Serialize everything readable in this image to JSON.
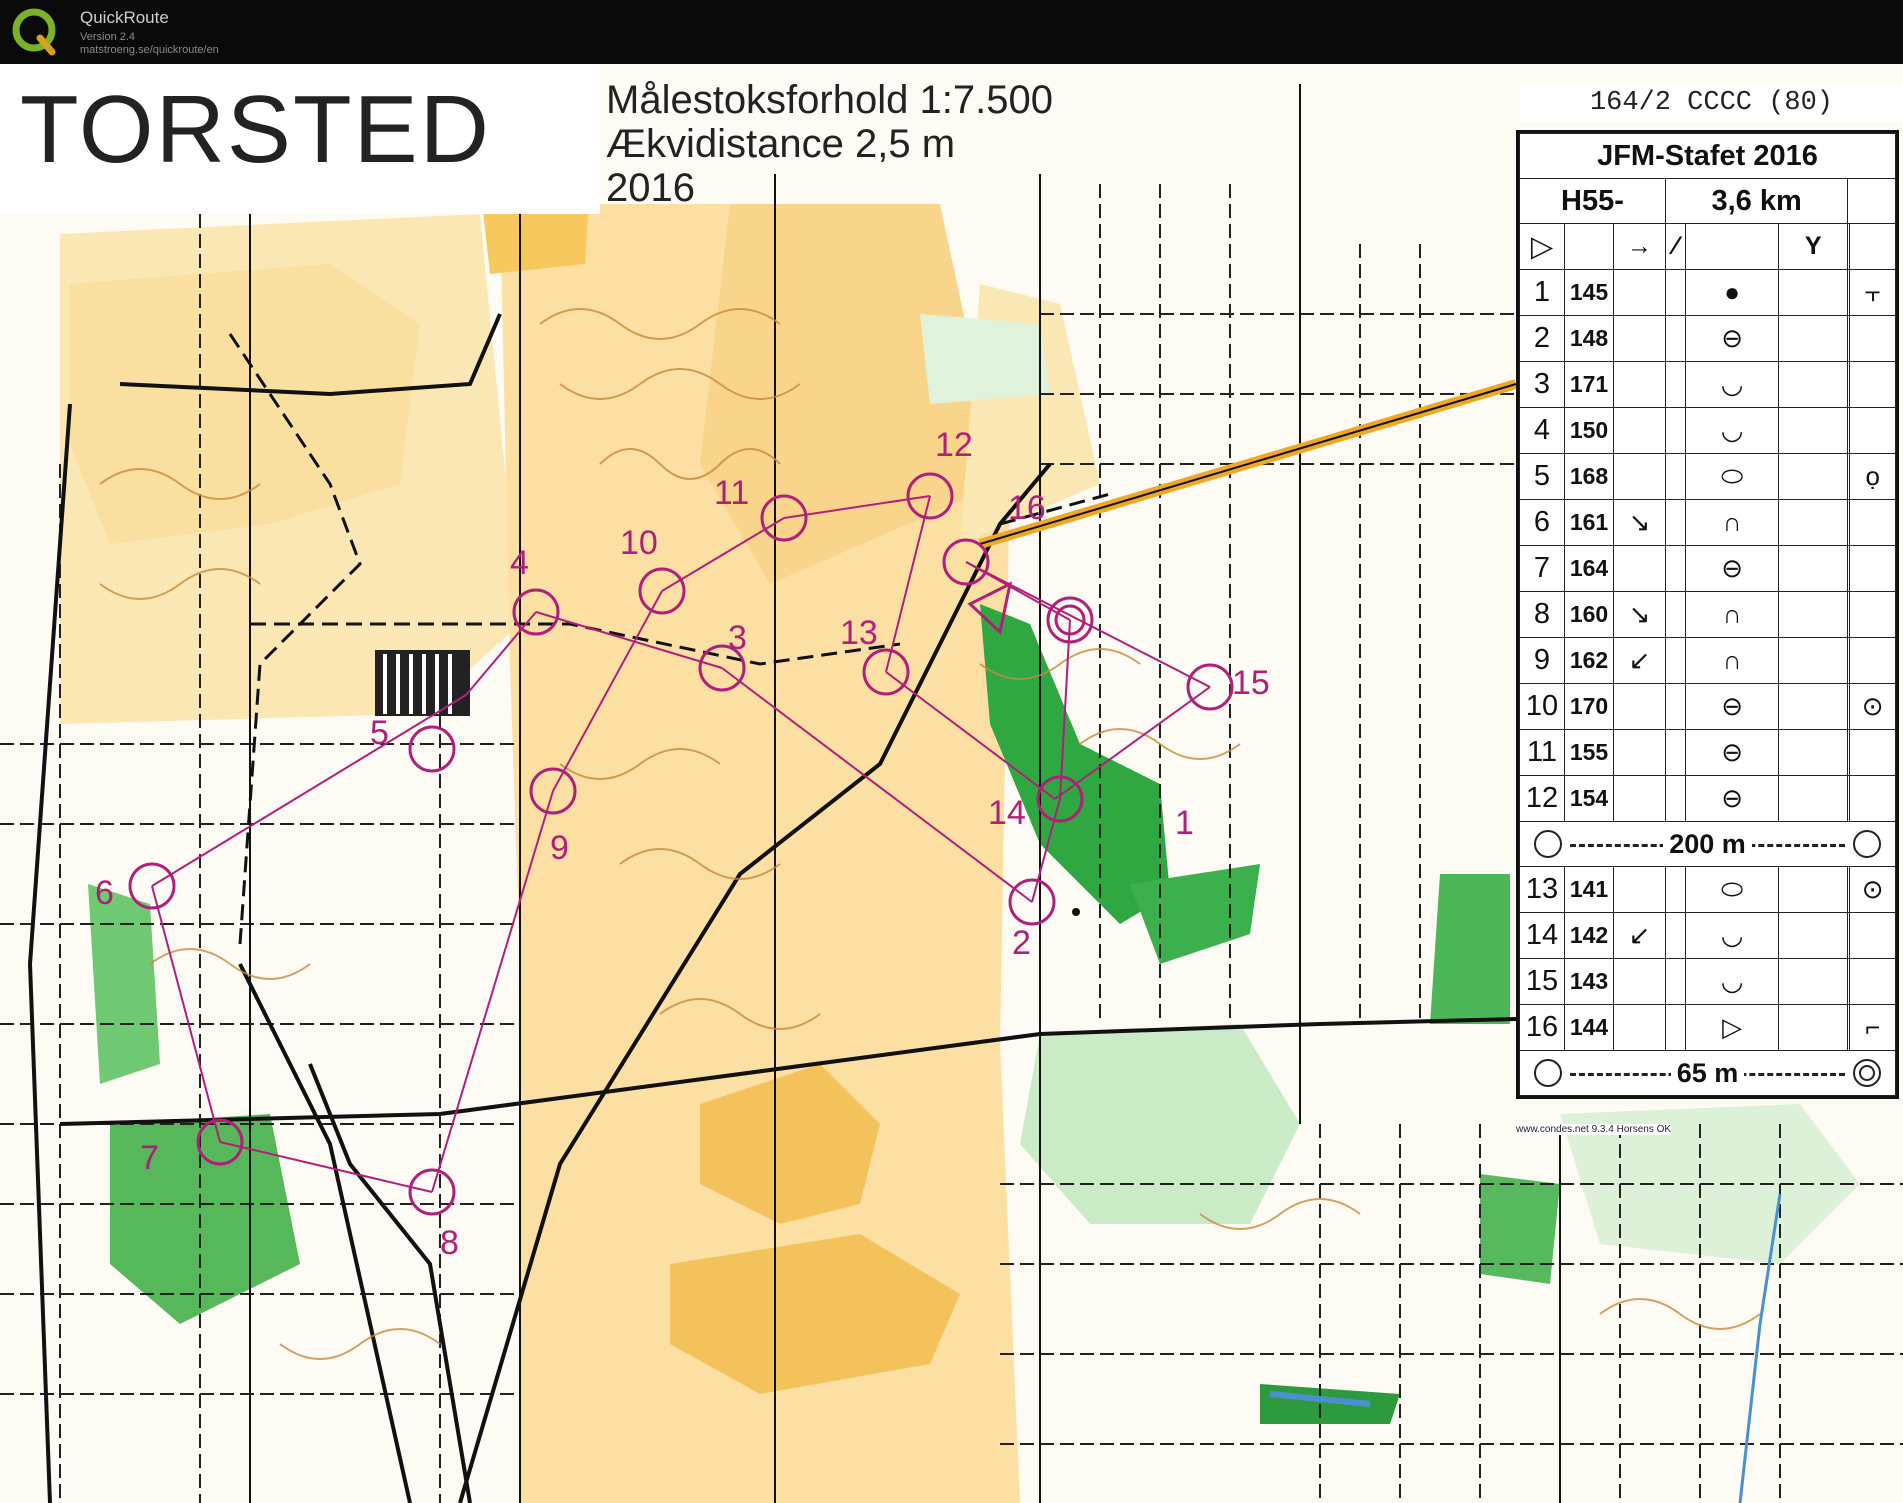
{
  "window": {
    "app_name": "QuickRoute",
    "version": "Version 2.4",
    "url": "matstroeng.se/quickroute/en",
    "logo_icon": "quickroute-q-logo-icon"
  },
  "map": {
    "title": "TORSTED",
    "scale_line": "Målestoksforhold 1:7.500",
    "contour_line": "Ækvidistance 2,5 m",
    "year": "2016",
    "course_color": "#b0207a",
    "credit": "www.condes.net 9.3.4 Horsens OK",
    "control_labels": [
      "1",
      "2",
      "3",
      "4",
      "5",
      "6",
      "7",
      "8",
      "9",
      "10",
      "11",
      "12",
      "13",
      "14",
      "15",
      "16"
    ]
  },
  "description": {
    "header": "164/2 CCCC (80)",
    "event": "JFM-Stafet 2016",
    "class": "H55-",
    "length": "3,6 km",
    "controls": [
      {
        "num": "1",
        "code": "145",
        "dir": "",
        "symbol": "●",
        "extra": "⫟"
      },
      {
        "num": "2",
        "code": "148",
        "dir": "",
        "symbol": "⊖",
        "extra": ""
      },
      {
        "num": "3",
        "code": "171",
        "dir": "",
        "symbol": "◡",
        "extra": ""
      },
      {
        "num": "4",
        "code": "150",
        "dir": "",
        "symbol": "◡",
        "extra": ""
      },
      {
        "num": "5",
        "code": "168",
        "dir": "",
        "symbol": "⬭",
        "extra": "ọ"
      },
      {
        "num": "6",
        "code": "161",
        "dir": "↘",
        "symbol": "∩",
        "extra": ""
      },
      {
        "num": "7",
        "code": "164",
        "dir": "",
        "symbol": "⊖",
        "extra": ""
      },
      {
        "num": "8",
        "code": "160",
        "dir": "↘",
        "symbol": "∩",
        "extra": ""
      },
      {
        "num": "9",
        "code": "162",
        "dir": "↙",
        "symbol": "∩",
        "extra": ""
      },
      {
        "num": "10",
        "code": "170",
        "dir": "",
        "symbol": "⊖",
        "extra": "⊙"
      },
      {
        "num": "11",
        "code": "155",
        "dir": "",
        "symbol": "⊖",
        "extra": ""
      },
      {
        "num": "12",
        "code": "154",
        "dir": "",
        "symbol": "⊖",
        "extra": ""
      }
    ],
    "taped_1": "200 m",
    "controls_2": [
      {
        "num": "13",
        "code": "141",
        "dir": "",
        "symbol": "⬭",
        "extra": "⊙"
      },
      {
        "num": "14",
        "code": "142",
        "dir": "↙",
        "symbol": "◡",
        "extra": ""
      },
      {
        "num": "15",
        "code": "143",
        "dir": "",
        "symbol": "◡",
        "extra": ""
      },
      {
        "num": "16",
        "code": "144",
        "dir": "",
        "symbol": "▷",
        "extra": "⌐"
      }
    ],
    "taped_2": "65 m"
  }
}
